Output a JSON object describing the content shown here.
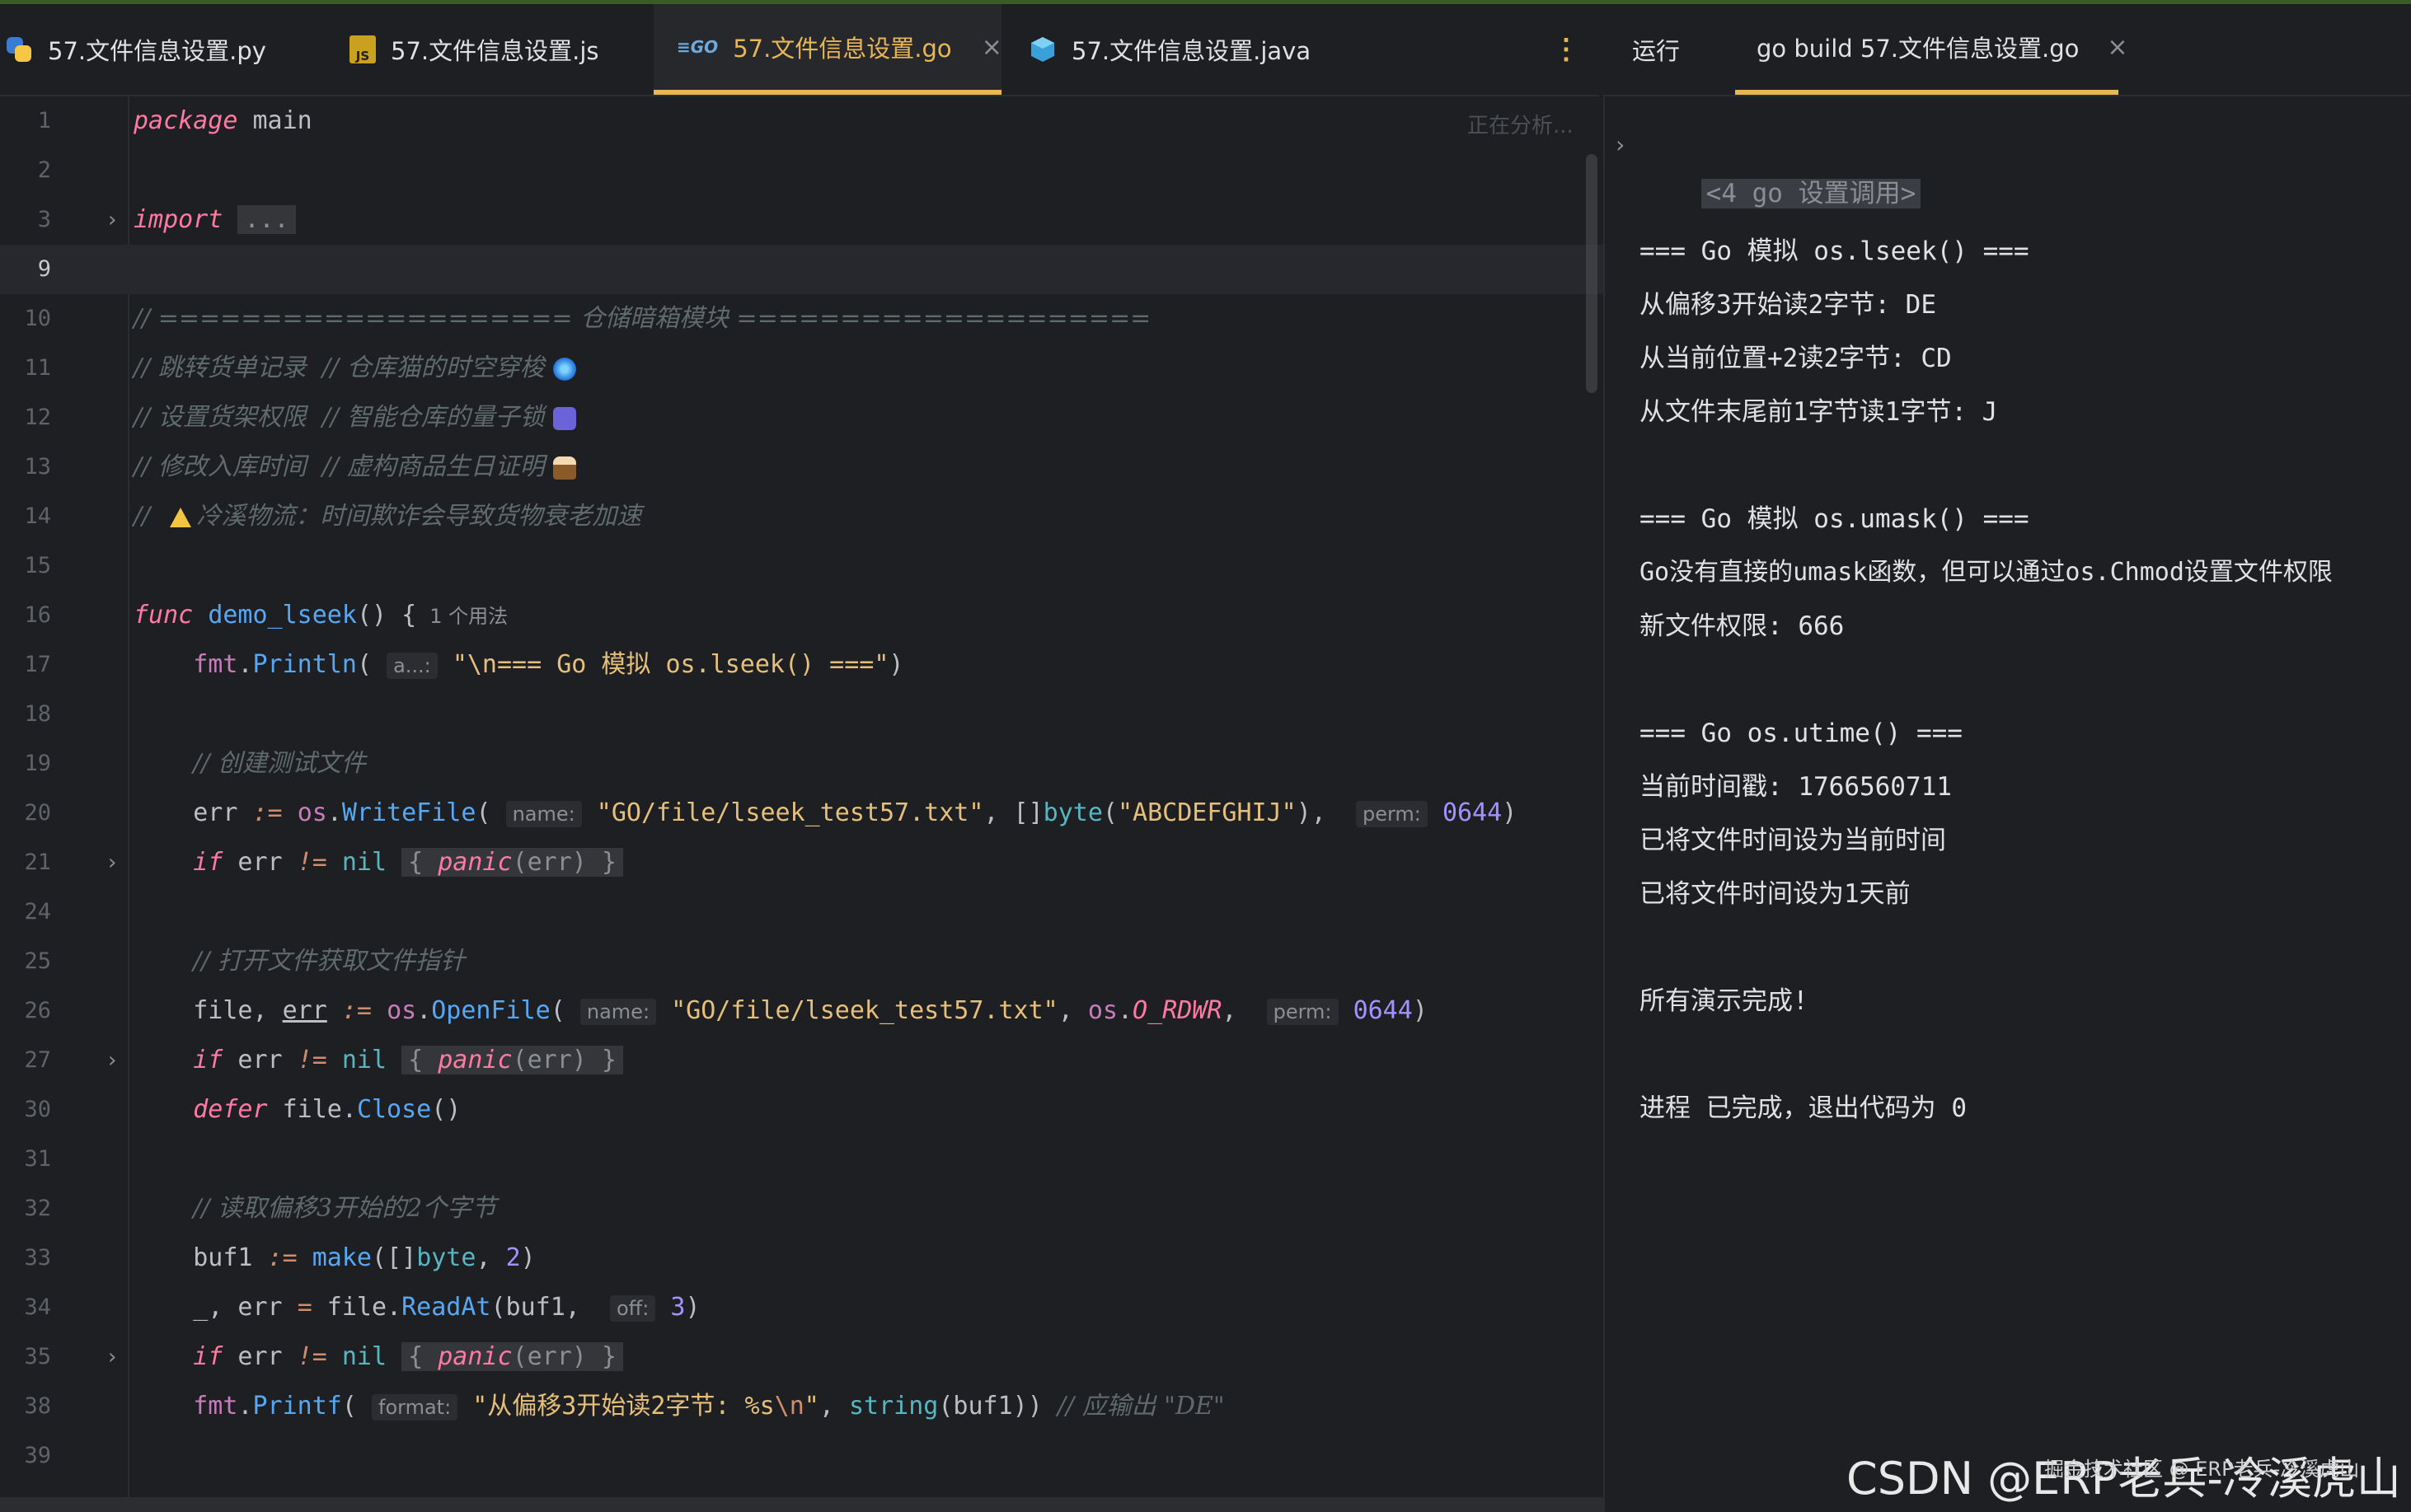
{
  "editor_tabs": [
    {
      "label": "57.文件信息设置.py",
      "icon": "python-icon"
    },
    {
      "label": "57.文件信息设置.js",
      "icon": "js-icon"
    },
    {
      "label": "57.文件信息设置.go",
      "icon": "go-icon",
      "active": true
    },
    {
      "label": "57.文件信息设置.java",
      "icon": "java-icon"
    }
  ],
  "tab_close": "×",
  "run_panel": {
    "title": "运行",
    "tab_label": "go build 57.文件信息设置.go",
    "close": "×"
  },
  "editor": {
    "analyzing": "正在分析...",
    "line_numbers": [
      "1",
      "2",
      "3",
      "9",
      "10",
      "11",
      "12",
      "13",
      "14",
      "15",
      "16",
      "17",
      "18",
      "19",
      "20",
      "21",
      "24",
      "25",
      "26",
      "27",
      "30",
      "31",
      "32",
      "33",
      "34",
      "35",
      "38",
      "39"
    ],
    "current_line": "9",
    "code": {
      "l1_kw": "package",
      "l1_name": "main",
      "l3_kw": "import",
      "l3_folded": "...",
      "c10": "// ==================== 仓储暗箱模块 ====================",
      "c11": "// 跳转货单记录  // 仓库猫的时空穿梭",
      "c12": "// 设置货架权限  // 智能仓库的量子锁",
      "c13": "// 修改入库时间  // 虚构商品生日证明",
      "c14_prefix": "//",
      "c14": "冷溪物流：时间欺诈会导致货物衰老加速",
      "l16_kw": "func",
      "l16_name": "demo_lseek",
      "l16_rest": "() {",
      "l16_usage": "1 个用法",
      "l17_hint": "a...:",
      "l17_str": "\"\\n=== Go 模拟 os.lseek() ===\"",
      "c19": "// 创建测试文件",
      "l20_hint_name": "name:",
      "l20_path": "\"GO/file/lseek_test57.txt\"",
      "l20_bytes": "\"ABCDEFGHIJ\"",
      "l20_hint_perm": "perm:",
      "l20_perm": "0644",
      "c25": "// 打开文件获取文件指针",
      "l26_hint_name": "name:",
      "l26_path": "\"GO/file/lseek_test57.txt\"",
      "l26_flag": "O_RDWR",
      "l26_hint_perm": "perm:",
      "l26_perm": "0644",
      "c32": "// 读取偏移3开始的2个字节",
      "l33_num": "2",
      "l34_hint_off": "off:",
      "l34_num": "3",
      "l38_hint": "format:",
      "l38_str_a": "\"从偏移3开始读2字节: %s",
      "l38_esc": "\\n",
      "l38_str_b": "\"",
      "l38_comment": "// 应输出 \"DE\""
    }
  },
  "output": {
    "cmd": "<4 go 设置调用>",
    "lines": [
      "=== Go 模拟 os.lseek() ===",
      "从偏移3开始读2字节: DE",
      "从当前位置+2读2字节: CD",
      "从文件末尾前1字节读1字节: J",
      "",
      "=== Go 模拟 os.umask() ===",
      "Go没有直接的umask函数，但可以通过os.Chmod设置文件权限",
      "新文件权限: 666",
      "",
      "=== Go os.utime() ===",
      "当前时间戳: 1766560711",
      "已将文件时间设为当前时间",
      "已将文件时间设为1天前",
      "",
      "所有演示完成!",
      "",
      "进程 已完成，退出代码为 0"
    ]
  },
  "watermark": "CSDN @ERP老兵-冷溪虎山",
  "watermark_sub": "掘金技术社区 @ ERP老兵-冷溪虎山",
  "colors": {
    "accent": "#e9b655",
    "background": "#1e1f22",
    "keyword": "#cf8e6d",
    "string": "#e6c07b"
  }
}
